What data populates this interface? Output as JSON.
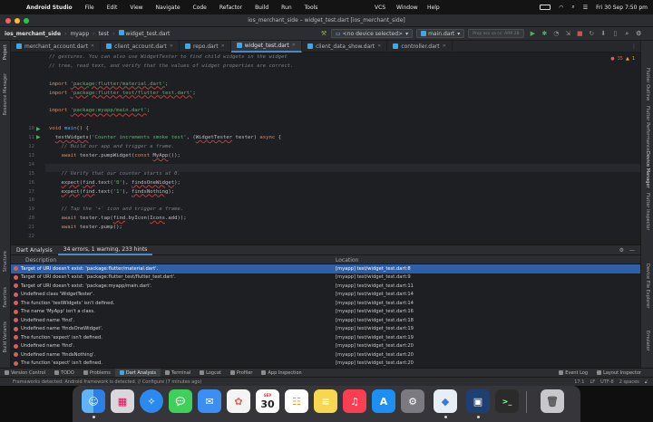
{
  "menubar": {
    "app": "Android Studio",
    "items": [
      "File",
      "Edit",
      "View",
      "Navigate",
      "Code",
      "Refactor",
      "Build",
      "Run",
      "Tools"
    ],
    "right_items": [
      "VCS",
      "Window",
      "Help"
    ],
    "datetime": "Fri 30 Sep 7:50 pm"
  },
  "window": {
    "title": "ios_merchant_side – widget_test.dart [ios_merchant_side]"
  },
  "navbar": {
    "crumbs": [
      "ios_merchant_side",
      "myapp",
      "test",
      "widget_test.dart"
    ],
    "device": "<no device selected>",
    "run_config": "main.dart",
    "search_placeholder": "Prop acs sa cc: ARR 28"
  },
  "tabs": [
    {
      "label": "merchant_account.dart",
      "active": false
    },
    {
      "label": "client_account.dart",
      "active": false
    },
    {
      "label": "repo.dart",
      "active": false
    },
    {
      "label": "widget_test.dart",
      "active": true
    },
    {
      "label": "client_data_show.dart",
      "active": false
    },
    {
      "label": "controller.dart",
      "active": false
    }
  ],
  "left_stripe": [
    "Project",
    "Resource Manager",
    "Structure",
    "Favorites",
    "Build Variants"
  ],
  "right_stripe": [
    "Flutter Outline",
    "Flutter Performance",
    "Device Manager",
    "Flutter Inspector",
    "Device File Explorer",
    "Emulator"
  ],
  "editor": {
    "inspection": {
      "errors": "35",
      "warnings": "1"
    },
    "lines": [
      {
        "n": "",
        "html": "<span class=\"c-com\">// gestures. You can also use WidgetTester to find child widgets in the widget</span>"
      },
      {
        "n": "",
        "html": "<span class=\"c-com\">// tree, read text, and verify that the values of widget properties are correct.</span>"
      },
      {
        "n": "",
        "html": ""
      },
      {
        "n": "",
        "html": "<span class=\"c-kw\">import</span> <span class=\"c-str\">'package:flutter/material.dart'</span>;"
      },
      {
        "n": "",
        "html": "<span class=\"c-kw\">import</span> <span class=\"c-str\">'package:flutter_test/flutter_test.dart'</span>;"
      },
      {
        "n": "",
        "html": ""
      },
      {
        "n": "",
        "html": "<span class=\"c-kw\">import</span> <span class=\"c-str\">'package:myapp/main.dart'</span>;"
      },
      {
        "n": "",
        "html": ""
      },
      {
        "n": "10",
        "html": "<span class=\"c-kw\">void</span> <span class=\"c-fn\">main</span>() {"
      },
      {
        "n": "11",
        "html": "  <span class=\"c-err\">testWidgets</span>(<span class=\"c-str2\">'Counter increments smoke test'</span>, (<span class=\"c-err\">WidgetTester</span> tester) <span class=\"c-kw\">async</span> {"
      },
      {
        "n": "12",
        "html": "    <span class=\"c-com\">// Build our app and trigger a frame.</span>"
      },
      {
        "n": "13",
        "html": "    <span class=\"c-kw\">await</span> tester.pumpWidget(<span class=\"c-kw\">const</span> <span class=\"c-err\">MyApp</span>());"
      },
      {
        "n": "14",
        "html": ""
      },
      {
        "n": "15",
        "html": "    <span class=\"c-com\">// Verify that our counter starts at 0.</span>"
      },
      {
        "n": "16",
        "html": "    <span class=\"c-err\">expect</span>(<span class=\"c-err\">find</span>.text(<span class=\"c-str2\">'0'</span>), <span class=\"c-err\">findsOneWidget</span>);"
      },
      {
        "n": "17",
        "html": "    <span class=\"c-err\">expect</span>(<span class=\"c-err\">find</span>.text(<span class=\"c-str2\">'1'</span>), <span class=\"c-err\">findsNothing</span>);"
      },
      {
        "n": "18",
        "html": ""
      },
      {
        "n": "19",
        "html": "    <span class=\"c-com\">// Tap the '+' icon and trigger a frame.</span>"
      },
      {
        "n": "20",
        "html": "    <span class=\"c-kw\">await</span> tester.tap(<span class=\"c-err\">find</span>.byIcon(<span class=\"c-err\">Icons</span>.add));"
      },
      {
        "n": "21",
        "html": "    <span class=\"c-kw\">await</span> tester.pump();"
      },
      {
        "n": "22",
        "html": ""
      }
    ]
  },
  "analysis": {
    "title": "Dart Analysis",
    "tab_label": "34 errors, 1 warning, 233 hints",
    "col_description": "Description",
    "col_location": "Location",
    "rows": [
      {
        "type": "error",
        "selected": true,
        "desc": "Target of URI doesn't exist: 'package:flutter/material.dart'.",
        "loc": "[myapp] test/widget_test.dart:8"
      },
      {
        "type": "error",
        "selected": false,
        "desc": "Target of URI doesn't exist: 'package:flutter_test/flutter_test.dart'.",
        "loc": "[myapp] test/widget_test.dart:9"
      },
      {
        "type": "error",
        "selected": false,
        "desc": "Target of URI doesn't exist: 'package:myapp/main.dart'.",
        "loc": "[myapp] test/widget_test.dart:11"
      },
      {
        "type": "error",
        "selected": false,
        "desc": "Undefined class 'WidgetTester'.",
        "loc": "[myapp] test/widget_test.dart:14"
      },
      {
        "type": "error",
        "selected": false,
        "desc": "The function 'testWidgets' isn't defined.",
        "loc": "[myapp] test/widget_test.dart:14"
      },
      {
        "type": "error",
        "selected": false,
        "desc": "The name 'MyApp' isn't a class.",
        "loc": "[myapp] test/widget_test.dart:16"
      },
      {
        "type": "error",
        "selected": false,
        "desc": "Undefined name 'find'.",
        "loc": "[myapp] test/widget_test.dart:18"
      },
      {
        "type": "error",
        "selected": false,
        "desc": "Undefined name 'findsOneWidget'.",
        "loc": "[myapp] test/widget_test.dart:19"
      },
      {
        "type": "error",
        "selected": false,
        "desc": "The function 'expect' isn't defined.",
        "loc": "[myapp] test/widget_test.dart:19"
      },
      {
        "type": "error",
        "selected": false,
        "desc": "Undefined name 'find'.",
        "loc": "[myapp] test/widget_test.dart:20"
      },
      {
        "type": "error",
        "selected": false,
        "desc": "Undefined name 'findsNothing'.",
        "loc": "[myapp] test/widget_test.dart:20"
      },
      {
        "type": "error",
        "selected": false,
        "desc": "The function 'expect' isn't defined.",
        "loc": "[myapp] test/widget_test.dart:20"
      }
    ]
  },
  "bottom_tabs": [
    "Version Control",
    "TODO",
    "Problems",
    "Dart Analysis",
    "Terminal",
    "Logcat",
    "Profiler",
    "App Inspection"
  ],
  "bottom_right_tabs": [
    "Event Log",
    "Layout Inspector"
  ],
  "status": {
    "message": "Frameworks detected: Android framework is detected. // Configure (7 minutes ago)",
    "position": "17:1",
    "line_sep": "LF",
    "encoding": "UTF-8",
    "indent": "2 spaces"
  },
  "dock": {
    "calendar_month": "SEP",
    "calendar_day": "30",
    "apps": [
      "finder-icon",
      "launchpad-icon",
      "safari-icon",
      "messages-icon",
      "mail-icon",
      "photos-icon",
      "calendar-icon",
      "reminders-icon",
      "notes-icon",
      "music-icon",
      "app-store-icon",
      "system-preferences-icon",
      "android-studio-icon",
      "preview-icon",
      "terminal-icon",
      "trash-icon"
    ]
  },
  "colors": {
    "selection": "#2e5fa8",
    "error": "#db5c5c",
    "warning": "#f0a732",
    "accent": "#4a88c7"
  }
}
